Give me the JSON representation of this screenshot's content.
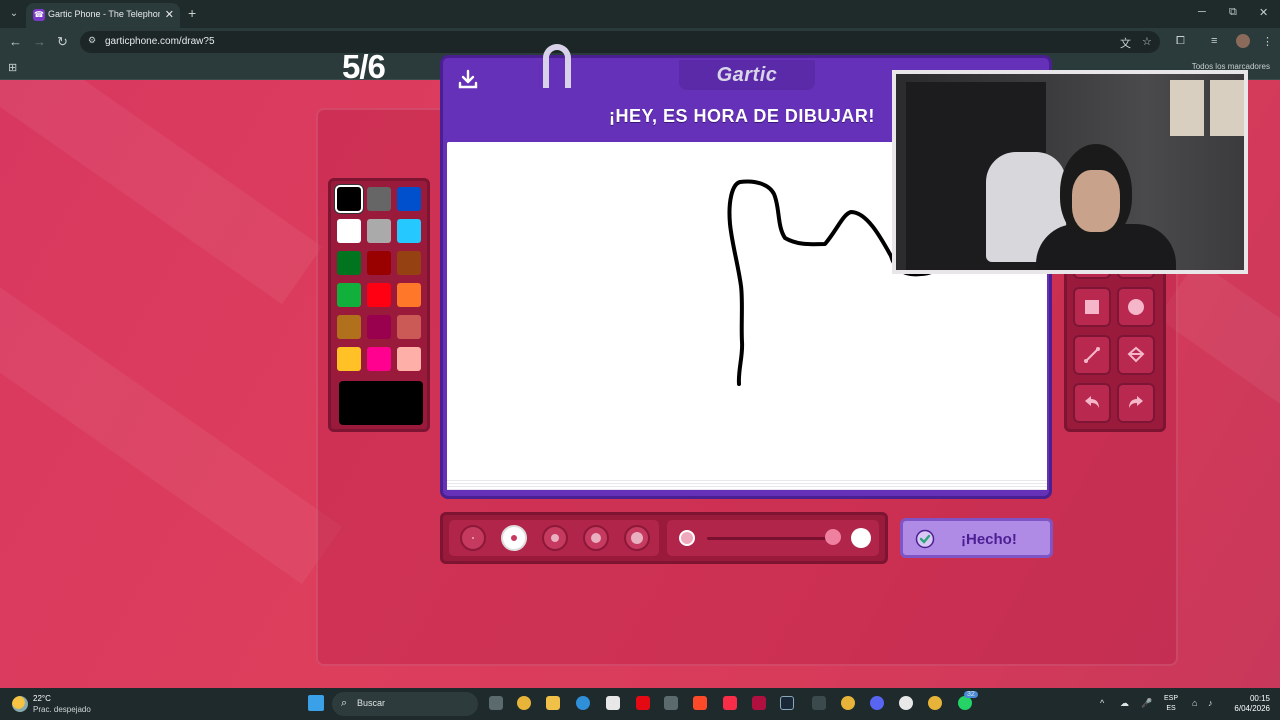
{
  "browser": {
    "tab_title": "Gartic Phone - The Telephone G",
    "url": "garticphone.com/draw?5",
    "bookmarks_label": "Todos los marcadores"
  },
  "game": {
    "round": "5/6",
    "logo": "Gartic",
    "prompt": "¡HEY, ES HORA DE DIBUJAR!",
    "done_label": "¡Hecho!",
    "palette": [
      "#000000",
      "#666666",
      "#0050cd",
      "#ffffff",
      "#aaaaaa",
      "#26c9ff",
      "#017420",
      "#990000",
      "#964112",
      "#11b03c",
      "#ff0013",
      "#ff7829",
      "#b0701c",
      "#99004e",
      "#cb5a57",
      "#ffc126",
      "#ff008f",
      "#feafa8"
    ],
    "selected_color": "#000000",
    "selected_size_index": 1,
    "tools": [
      "pen-icon",
      "eraser-icon",
      "rectangle-icon",
      "ellipse-icon",
      "filled-rectangle-icon",
      "filled-ellipse-icon",
      "line-icon",
      "fill-bucket-icon",
      "undo-icon",
      "redo-icon"
    ],
    "active_tool": "pen-icon"
  },
  "taskbar": {
    "temperature": "22°C",
    "condition": "Prac. despejado",
    "search_label": "Buscar",
    "lang_line1": "ESP",
    "lang_line2": "ES",
    "time": "00:15",
    "date": "6/04/2026",
    "badge": "32"
  }
}
